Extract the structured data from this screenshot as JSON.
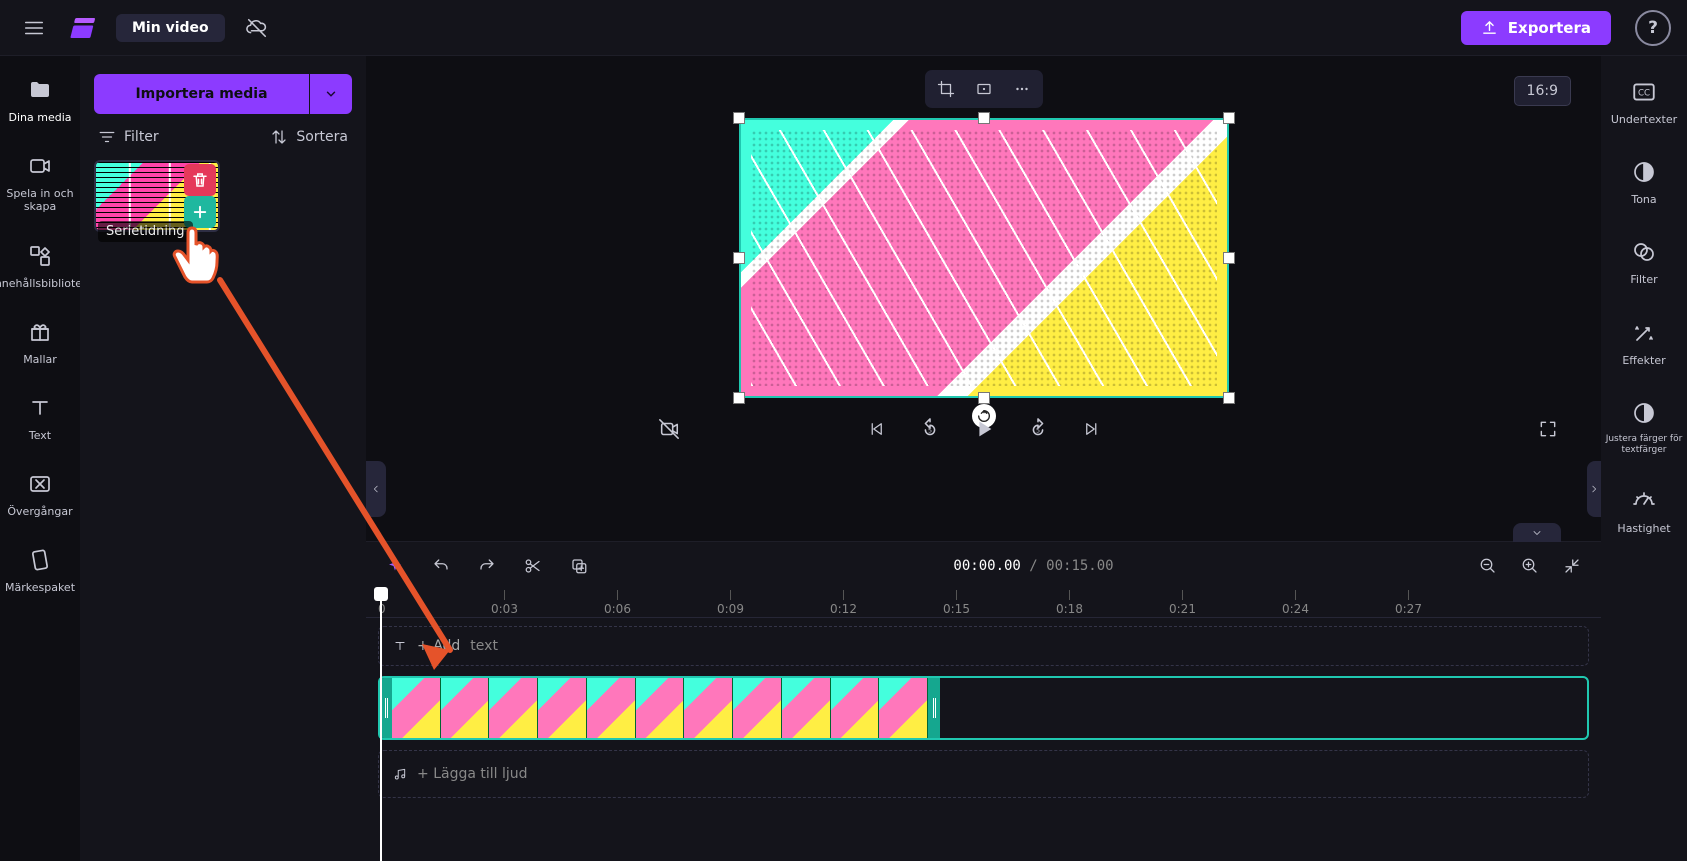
{
  "app": {
    "title": "Min video"
  },
  "topbar": {
    "export_label": "Exportera"
  },
  "nav": {
    "items": [
      {
        "label": "Dina media"
      },
      {
        "label": "Spela in och skapa"
      },
      {
        "label": "Innehållsbibliotek"
      },
      {
        "label": "Mallar"
      },
      {
        "label": "Text"
      },
      {
        "label": "Övergångar"
      },
      {
        "label": "Märkespaket"
      }
    ]
  },
  "media": {
    "import_label": "Importera media",
    "filter_label": "Filter",
    "sort_label": "Sortera",
    "clips": [
      {
        "name": "Serietidning"
      }
    ]
  },
  "preview": {
    "aspect": "16:9"
  },
  "playback": {
    "skip_back": "5",
    "skip_fwd": "5",
    "current": "00:00.00",
    "total": "00:15.00"
  },
  "timeline": {
    "ticks": [
      "0",
      "0:03",
      "0:06",
      "0:09",
      "0:12",
      "0:15",
      "0:18",
      "0:21",
      "0:24",
      "0:27"
    ],
    "text_track_prefix": "T",
    "text_track_add": "Add",
    "text_track_suffix": "text",
    "audio_track_label": "Lägga till ljud"
  },
  "rpanel": {
    "items": [
      {
        "label": "Undertexter"
      },
      {
        "label": "Tona"
      },
      {
        "label": "Filter"
      },
      {
        "label": "Effekter"
      },
      {
        "label": "Justera färger för textfärger"
      },
      {
        "label": "Hastighet"
      }
    ]
  }
}
